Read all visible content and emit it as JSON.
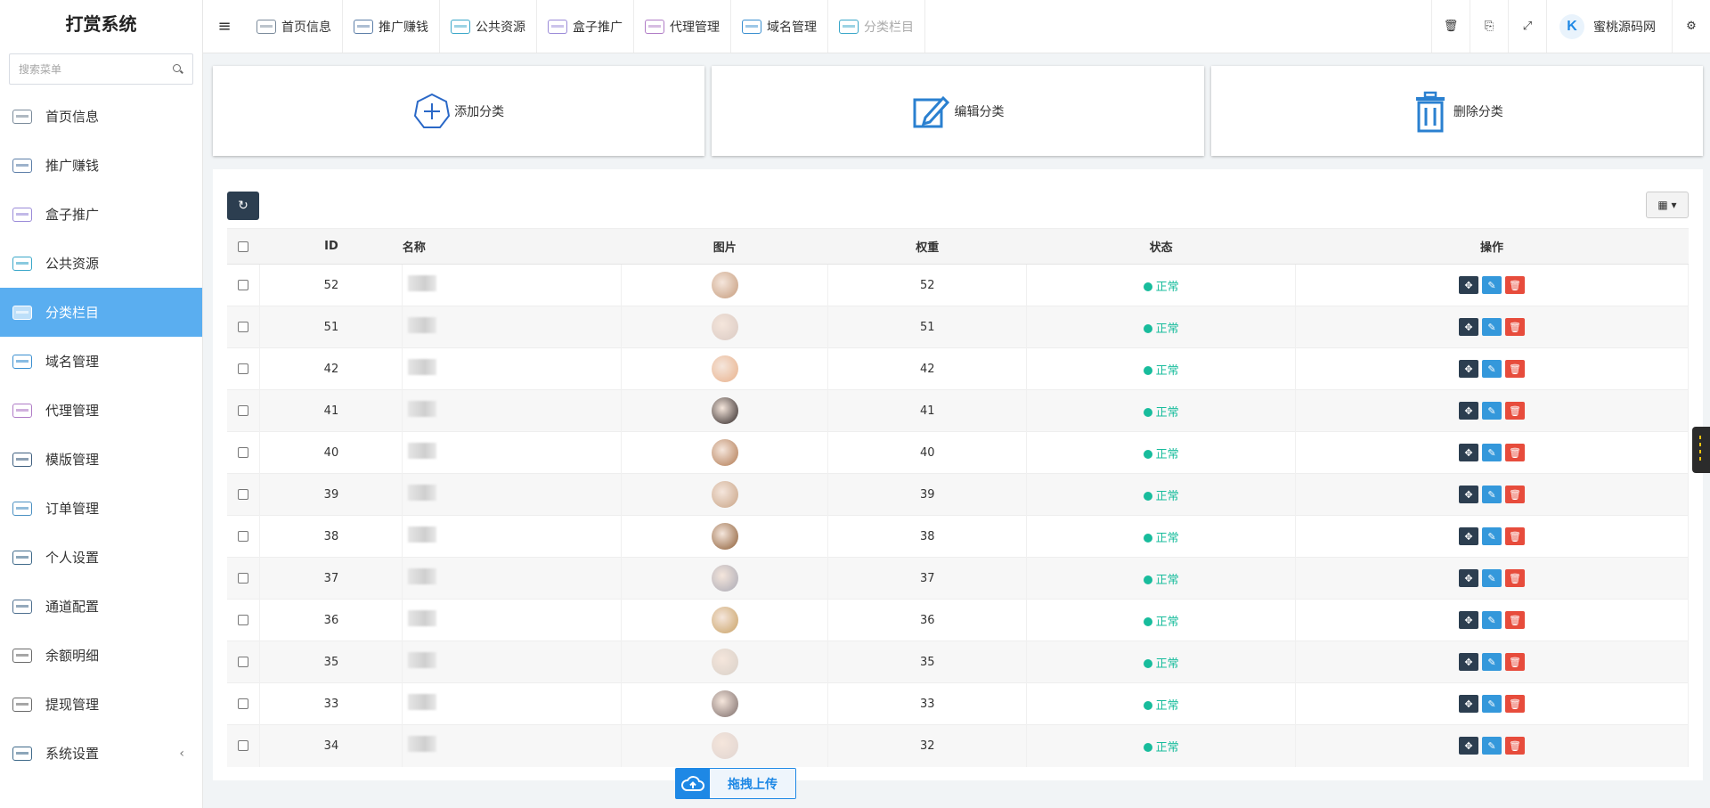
{
  "sidebar": {
    "brand": "打赏系统",
    "search_placeholder": "搜索菜单",
    "items": [
      {
        "label": "首页信息",
        "icon": "gallery-icon",
        "color": "#7a8a9a"
      },
      {
        "label": "推广赚钱",
        "icon": "megaphone-icon",
        "color": "#5c7ea8"
      },
      {
        "label": "盒子推广",
        "icon": "box-icon",
        "color": "#9a8ad8"
      },
      {
        "label": "公共资源",
        "icon": "network-icon",
        "color": "#3aa7c9"
      },
      {
        "label": "分类栏目",
        "icon": "sort-icon",
        "color": "#ffffff"
      },
      {
        "label": "域名管理",
        "icon": "web-icon",
        "color": "#3a8fd0"
      },
      {
        "label": "代理管理",
        "icon": "cart-icon",
        "color": "#b07cc6"
      },
      {
        "label": "模版管理",
        "icon": "globe-icon",
        "color": "#3f5f7f"
      },
      {
        "label": "订单管理",
        "icon": "chart-icon",
        "color": "#4a90c2"
      },
      {
        "label": "个人设置",
        "icon": "profile-icon",
        "color": "#3f6a8a"
      },
      {
        "label": "通道配置",
        "icon": "config-icon",
        "color": "#4e6f8f"
      },
      {
        "label": "余额明细",
        "icon": "wallet-icon",
        "color": "#6a6a6a"
      },
      {
        "label": "提现管理",
        "icon": "withdraw-icon",
        "color": "#6a6a6a"
      },
      {
        "label": "系统设置",
        "icon": "settings-icon",
        "color": "#3f6a8a"
      }
    ],
    "collapse_glyph": "‹"
  },
  "topnav": {
    "tabs": [
      {
        "label": "首页信息",
        "color": "#7a8a9a"
      },
      {
        "label": "推广赚钱",
        "color": "#5c7ea8"
      },
      {
        "label": "公共资源",
        "color": "#3aa7c9"
      },
      {
        "label": "盒子推广",
        "color": "#9a8ad8"
      },
      {
        "label": "代理管理",
        "color": "#b07cc6"
      },
      {
        "label": "域名管理",
        "color": "#3a8fd0"
      },
      {
        "label": "分类栏目",
        "color": "#3aa7c9"
      }
    ],
    "user_name": "蜜桃源码网",
    "avatar_letter": "K"
  },
  "actions": {
    "add": "添加分类",
    "edit": "编辑分类",
    "delete": "删除分类"
  },
  "table": {
    "headers": [
      "ID",
      "名称",
      "图片",
      "权重",
      "状态",
      "操作"
    ],
    "rows": [
      {
        "id": "52",
        "weight": "52",
        "status": "正常",
        "img": "#c49a7a"
      },
      {
        "id": "51",
        "weight": "51",
        "status": "正常",
        "img": "#d9c9c2"
      },
      {
        "id": "42",
        "weight": "42",
        "status": "正常",
        "img": "#e8b08a"
      },
      {
        "id": "41",
        "weight": "41",
        "status": "正常",
        "img": "#2a2222"
      },
      {
        "id": "40",
        "weight": "40",
        "status": "正常",
        "img": "#b07850"
      },
      {
        "id": "39",
        "weight": "39",
        "status": "正常",
        "img": "#c7a284"
      },
      {
        "id": "38",
        "weight": "38",
        "status": "正常",
        "img": "#8a5a32"
      },
      {
        "id": "37",
        "weight": "37",
        "status": "正常",
        "img": "#a8a8b4"
      },
      {
        "id": "36",
        "weight": "36",
        "status": "正常",
        "img": "#c8a062"
      },
      {
        "id": "35",
        "weight": "35",
        "status": "正常",
        "img": "#d8d0c8"
      },
      {
        "id": "33",
        "weight": "33",
        "status": "正常",
        "img": "#7a6a68"
      },
      {
        "id": "34",
        "weight": "32",
        "status": "正常",
        "img": "#e0d4d0"
      }
    ]
  },
  "upload": {
    "label": "拖拽上传"
  },
  "colors": {
    "accent": "#5aaef0",
    "success": "#18bc9c",
    "danger": "#e74c3c",
    "dark": "#2c3e50",
    "info": "#3498db"
  }
}
